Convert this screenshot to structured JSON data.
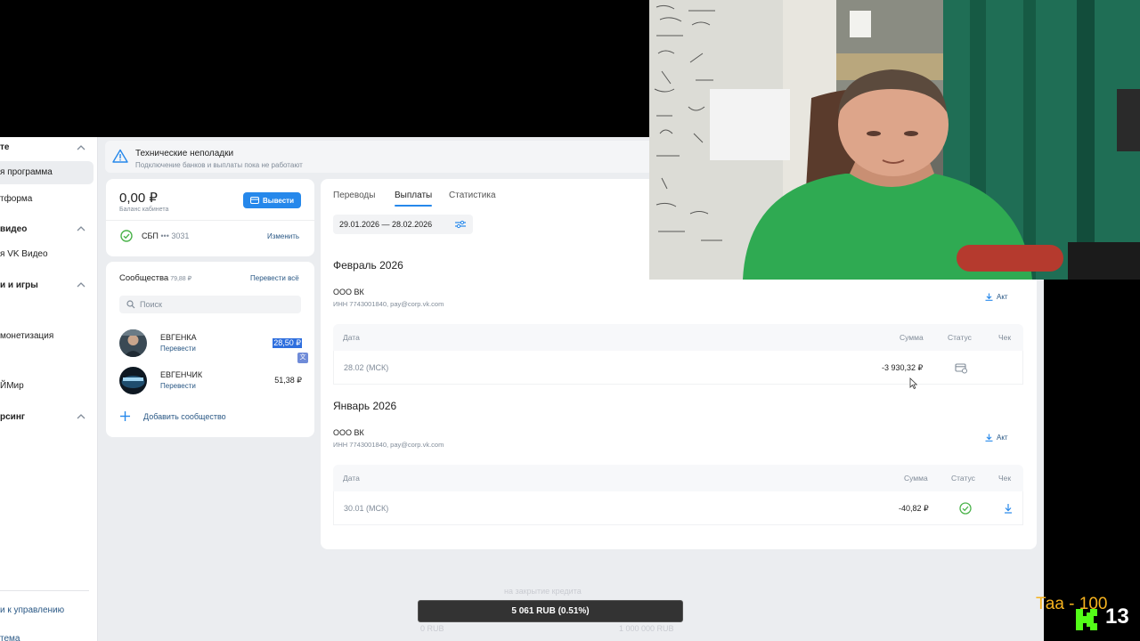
{
  "sidebar": {
    "items": [
      {
        "label": "те",
        "type": "section"
      },
      {
        "label": "я программа",
        "type": "active"
      },
      {
        "label": "тформа",
        "type": "item"
      },
      {
        "label": "видео",
        "type": "section"
      },
      {
        "label": "я VK Видео",
        "type": "item"
      },
      {
        "label": "и и игры",
        "type": "section"
      },
      {
        "label": "монетизация",
        "type": "item"
      },
      {
        "label": "ЙМир",
        "type": "item"
      },
      {
        "label": "рсинг",
        "type": "section"
      }
    ],
    "footer_links": [
      "и к управлению",
      "тема"
    ]
  },
  "notice": {
    "title": "Технические неполадки",
    "text": "Подключение банков и выплаты пока не работают",
    "icon": "warning-icon"
  },
  "balance": {
    "amount": "0,00 ₽",
    "caption": "Баланс кабинета",
    "withdraw_label": "Вывести",
    "sbp_label": "СБП",
    "sbp_number": "••• 3031",
    "change_label": "Изменить"
  },
  "communities": {
    "title": "Сообщества",
    "title_amount": "79,88 ₽",
    "transfer_all_label": "Перевести всё",
    "search_placeholder": "Поиск",
    "items": [
      {
        "name": "ЕВГЕНКА",
        "action": "Перевести",
        "value": "28,50 ₽"
      },
      {
        "name": "ЕВГЕНЧИК",
        "action": "Перевести",
        "value": "51,38 ₽"
      }
    ],
    "add_label": "Добавить сообщество"
  },
  "main": {
    "tabs": [
      "Переводы",
      "Выплаты",
      "Статистика"
    ],
    "active_tab": "Выплаты",
    "period": "29.01.2026 — 28.02.2026",
    "columns": {
      "date": "Дата",
      "sum": "Сумма",
      "status": "Статус",
      "receipt": "Чек"
    },
    "months": [
      {
        "title": "Февраль 2026",
        "org": "ООО ВК",
        "org_details": "ИНН 7743001840, pay@corp.vk.com",
        "act_label": "Акт",
        "rows": [
          {
            "date": "28.02 (МСК)",
            "sum": "-3 930,32 ₽",
            "status_icon": "card-pending-icon",
            "receipt": ""
          }
        ]
      },
      {
        "title": "Январь 2026",
        "org": "ООО ВК",
        "org_details": "ИНН 7743001840, pay@corp.vk.com",
        "act_label": "Акт",
        "rows": [
          {
            "date": "30.01 (МСК)",
            "sum": "-40,82 ₽",
            "status_icon": "check-circle-icon",
            "receipt": "download-icon"
          }
        ]
      }
    ]
  },
  "overlay": {
    "donation_goal_caption": "на закрытие кредита",
    "donation_value": "5 061 RUB (0.51%)",
    "donation_min": "0 RUB",
    "donation_max": "1 000 000 RUB",
    "taa_text": "Таа - 100",
    "counter": "13"
  },
  "colors": {
    "accent": "#2688eb",
    "link": "#2a5885",
    "success": "#4bb34b",
    "background": "#ebedf0"
  }
}
